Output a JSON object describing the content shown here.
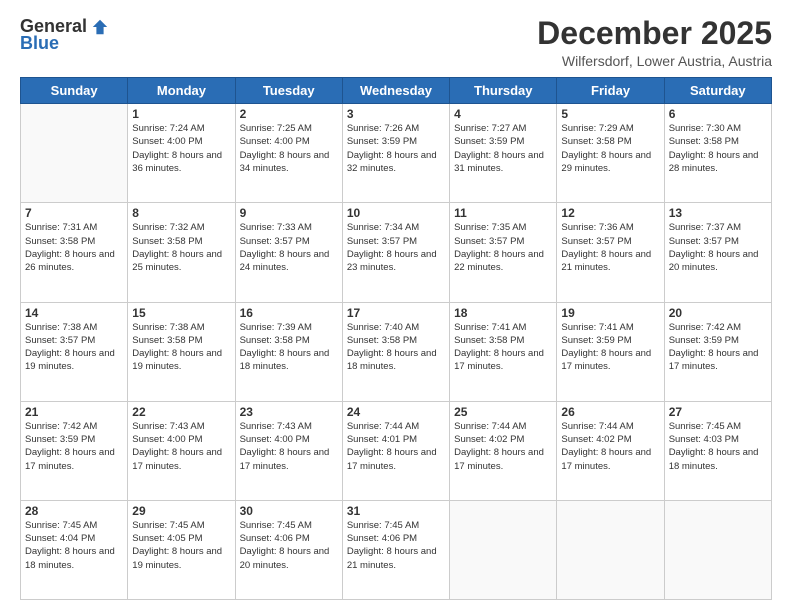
{
  "header": {
    "logo": {
      "general": "General",
      "blue": "Blue"
    },
    "title": "December 2025",
    "subtitle": "Wilfersdorf, Lower Austria, Austria"
  },
  "calendar": {
    "days_of_week": [
      "Sunday",
      "Monday",
      "Tuesday",
      "Wednesday",
      "Thursday",
      "Friday",
      "Saturday"
    ],
    "weeks": [
      [
        {
          "day": "",
          "sunrise": "",
          "sunset": "",
          "daylight": ""
        },
        {
          "day": "1",
          "sunrise": "Sunrise: 7:24 AM",
          "sunset": "Sunset: 4:00 PM",
          "daylight": "Daylight: 8 hours and 36 minutes."
        },
        {
          "day": "2",
          "sunrise": "Sunrise: 7:25 AM",
          "sunset": "Sunset: 4:00 PM",
          "daylight": "Daylight: 8 hours and 34 minutes."
        },
        {
          "day": "3",
          "sunrise": "Sunrise: 7:26 AM",
          "sunset": "Sunset: 3:59 PM",
          "daylight": "Daylight: 8 hours and 32 minutes."
        },
        {
          "day": "4",
          "sunrise": "Sunrise: 7:27 AM",
          "sunset": "Sunset: 3:59 PM",
          "daylight": "Daylight: 8 hours and 31 minutes."
        },
        {
          "day": "5",
          "sunrise": "Sunrise: 7:29 AM",
          "sunset": "Sunset: 3:58 PM",
          "daylight": "Daylight: 8 hours and 29 minutes."
        },
        {
          "day": "6",
          "sunrise": "Sunrise: 7:30 AM",
          "sunset": "Sunset: 3:58 PM",
          "daylight": "Daylight: 8 hours and 28 minutes."
        }
      ],
      [
        {
          "day": "7",
          "sunrise": "Sunrise: 7:31 AM",
          "sunset": "Sunset: 3:58 PM",
          "daylight": "Daylight: 8 hours and 26 minutes."
        },
        {
          "day": "8",
          "sunrise": "Sunrise: 7:32 AM",
          "sunset": "Sunset: 3:58 PM",
          "daylight": "Daylight: 8 hours and 25 minutes."
        },
        {
          "day": "9",
          "sunrise": "Sunrise: 7:33 AM",
          "sunset": "Sunset: 3:57 PM",
          "daylight": "Daylight: 8 hours and 24 minutes."
        },
        {
          "day": "10",
          "sunrise": "Sunrise: 7:34 AM",
          "sunset": "Sunset: 3:57 PM",
          "daylight": "Daylight: 8 hours and 23 minutes."
        },
        {
          "day": "11",
          "sunrise": "Sunrise: 7:35 AM",
          "sunset": "Sunset: 3:57 PM",
          "daylight": "Daylight: 8 hours and 22 minutes."
        },
        {
          "day": "12",
          "sunrise": "Sunrise: 7:36 AM",
          "sunset": "Sunset: 3:57 PM",
          "daylight": "Daylight: 8 hours and 21 minutes."
        },
        {
          "day": "13",
          "sunrise": "Sunrise: 7:37 AM",
          "sunset": "Sunset: 3:57 PM",
          "daylight": "Daylight: 8 hours and 20 minutes."
        }
      ],
      [
        {
          "day": "14",
          "sunrise": "Sunrise: 7:38 AM",
          "sunset": "Sunset: 3:57 PM",
          "daylight": "Daylight: 8 hours and 19 minutes."
        },
        {
          "day": "15",
          "sunrise": "Sunrise: 7:38 AM",
          "sunset": "Sunset: 3:58 PM",
          "daylight": "Daylight: 8 hours and 19 minutes."
        },
        {
          "day": "16",
          "sunrise": "Sunrise: 7:39 AM",
          "sunset": "Sunset: 3:58 PM",
          "daylight": "Daylight: 8 hours and 18 minutes."
        },
        {
          "day": "17",
          "sunrise": "Sunrise: 7:40 AM",
          "sunset": "Sunset: 3:58 PM",
          "daylight": "Daylight: 8 hours and 18 minutes."
        },
        {
          "day": "18",
          "sunrise": "Sunrise: 7:41 AM",
          "sunset": "Sunset: 3:58 PM",
          "daylight": "Daylight: 8 hours and 17 minutes."
        },
        {
          "day": "19",
          "sunrise": "Sunrise: 7:41 AM",
          "sunset": "Sunset: 3:59 PM",
          "daylight": "Daylight: 8 hours and 17 minutes."
        },
        {
          "day": "20",
          "sunrise": "Sunrise: 7:42 AM",
          "sunset": "Sunset: 3:59 PM",
          "daylight": "Daylight: 8 hours and 17 minutes."
        }
      ],
      [
        {
          "day": "21",
          "sunrise": "Sunrise: 7:42 AM",
          "sunset": "Sunset: 3:59 PM",
          "daylight": "Daylight: 8 hours and 17 minutes."
        },
        {
          "day": "22",
          "sunrise": "Sunrise: 7:43 AM",
          "sunset": "Sunset: 4:00 PM",
          "daylight": "Daylight: 8 hours and 17 minutes."
        },
        {
          "day": "23",
          "sunrise": "Sunrise: 7:43 AM",
          "sunset": "Sunset: 4:00 PM",
          "daylight": "Daylight: 8 hours and 17 minutes."
        },
        {
          "day": "24",
          "sunrise": "Sunrise: 7:44 AM",
          "sunset": "Sunset: 4:01 PM",
          "daylight": "Daylight: 8 hours and 17 minutes."
        },
        {
          "day": "25",
          "sunrise": "Sunrise: 7:44 AM",
          "sunset": "Sunset: 4:02 PM",
          "daylight": "Daylight: 8 hours and 17 minutes."
        },
        {
          "day": "26",
          "sunrise": "Sunrise: 7:44 AM",
          "sunset": "Sunset: 4:02 PM",
          "daylight": "Daylight: 8 hours and 17 minutes."
        },
        {
          "day": "27",
          "sunrise": "Sunrise: 7:45 AM",
          "sunset": "Sunset: 4:03 PM",
          "daylight": "Daylight: 8 hours and 18 minutes."
        }
      ],
      [
        {
          "day": "28",
          "sunrise": "Sunrise: 7:45 AM",
          "sunset": "Sunset: 4:04 PM",
          "daylight": "Daylight: 8 hours and 18 minutes."
        },
        {
          "day": "29",
          "sunrise": "Sunrise: 7:45 AM",
          "sunset": "Sunset: 4:05 PM",
          "daylight": "Daylight: 8 hours and 19 minutes."
        },
        {
          "day": "30",
          "sunrise": "Sunrise: 7:45 AM",
          "sunset": "Sunset: 4:06 PM",
          "daylight": "Daylight: 8 hours and 20 minutes."
        },
        {
          "day": "31",
          "sunrise": "Sunrise: 7:45 AM",
          "sunset": "Sunset: 4:06 PM",
          "daylight": "Daylight: 8 hours and 21 minutes."
        },
        {
          "day": "",
          "sunrise": "",
          "sunset": "",
          "daylight": ""
        },
        {
          "day": "",
          "sunrise": "",
          "sunset": "",
          "daylight": ""
        },
        {
          "day": "",
          "sunrise": "",
          "sunset": "",
          "daylight": ""
        }
      ]
    ]
  }
}
